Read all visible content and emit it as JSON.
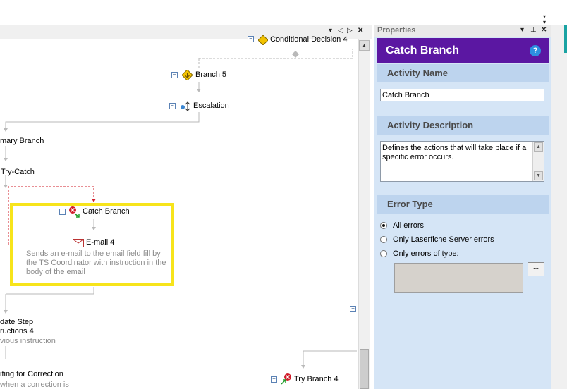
{
  "designer": {
    "header_buttons": [
      "▾",
      "◁",
      "▷",
      "✕"
    ],
    "nodes": {
      "conditional_decision": "Conditional Decision 4",
      "branch5": "Branch 5",
      "escalation": "Escalation",
      "primary_branch": "mary Branch",
      "try_catch": "Try-Catch",
      "catch_branch": "Catch Branch",
      "email4": "E-mail 4",
      "email4_desc": "Sends an e-mail to the email field fill by the TS Coordinator with instruction in the body of the email",
      "update_step": "date Step",
      "instructions": "ructions 4",
      "previous_instruction": "vious instruction",
      "waiting": "iting for Correction",
      "waiting_desc": "when a correction is",
      "try_branch4": "Try Branch 4"
    }
  },
  "properties": {
    "pane_title": "Properties",
    "pane_buttons": [
      "▾",
      "⊥",
      "✕"
    ],
    "header_title": "Catch Branch",
    "help_icon": "?",
    "sections": {
      "activity_name": "Activity Name",
      "activity_description": "Activity Description",
      "error_type": "Error Type"
    },
    "activity_name_value": "Catch Branch",
    "activity_description_value": "Defines the actions that will take place if a specific error occurs.",
    "error_options": [
      {
        "label": "All errors",
        "selected": true
      },
      {
        "label": "Only Laserfiche Server errors",
        "selected": false
      },
      {
        "label": "Only errors of type:",
        "selected": false
      }
    ],
    "ellipsis_label": "..."
  },
  "colors": {
    "header_purple": "#5b17a2",
    "panel_blue": "#d5e5f6",
    "section_blue": "#bdd4ee",
    "highlight_yellow": "#f7e41b",
    "catch_line_red": "#d01c2a"
  }
}
